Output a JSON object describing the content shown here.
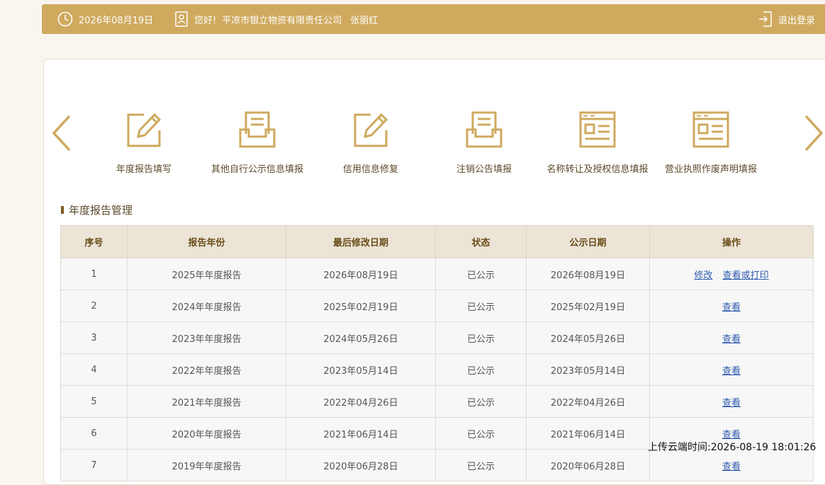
{
  "topbar": {
    "date": "2026年08月19日",
    "greeting": "您好!",
    "company": "平凉市银立物资有限责任公司",
    "user": "张丽红",
    "logout": "退出登录"
  },
  "nav": [
    {
      "label": "年度报告填写",
      "icon": "pencil-form-icon"
    },
    {
      "label": "其他自行公示信息填报",
      "icon": "document-tray-icon"
    },
    {
      "label": "信用信息修复",
      "icon": "pencil-form-icon"
    },
    {
      "label": "注销公告填报",
      "icon": "document-tray-icon"
    },
    {
      "label": "名称转让及授权信息填报",
      "icon": "browser-window-icon"
    },
    {
      "label": "营业执照作废声明填报",
      "icon": "browser-window-icon"
    }
  ],
  "section": {
    "title": "年度报告管理"
  },
  "table": {
    "headers": [
      "序号",
      "报告年份",
      "最后修改日期",
      "状态",
      "公示日期",
      "操作"
    ],
    "rows": [
      {
        "no": "1",
        "year": "2025年年度报告",
        "modified": "2026年08月19日",
        "status": "已公示",
        "published": "2026年08月19日",
        "actions": [
          "修改",
          "查看或打印"
        ]
      },
      {
        "no": "2",
        "year": "2024年年度报告",
        "modified": "2025年02月19日",
        "status": "已公示",
        "published": "2025年02月19日",
        "actions": [
          "查看"
        ]
      },
      {
        "no": "3",
        "year": "2023年年度报告",
        "modified": "2024年05月26日",
        "status": "已公示",
        "published": "2024年05月26日",
        "actions": [
          "查看"
        ]
      },
      {
        "no": "4",
        "year": "2022年年度报告",
        "modified": "2023年05月14日",
        "status": "已公示",
        "published": "2023年05月14日",
        "actions": [
          "查看"
        ]
      },
      {
        "no": "5",
        "year": "2021年年度报告",
        "modified": "2022年04月26日",
        "status": "已公示",
        "published": "2022年04月26日",
        "actions": [
          "查看"
        ]
      },
      {
        "no": "6",
        "year": "2020年年度报告",
        "modified": "2021年06月14日",
        "status": "已公示",
        "published": "2021年06月14日",
        "actions": [
          "查看"
        ]
      },
      {
        "no": "7",
        "year": "2019年年度报告",
        "modified": "2020年06月28日",
        "status": "已公示",
        "published": "2020年06月28日",
        "actions": [
          "查看"
        ]
      }
    ]
  },
  "footer": {
    "upload_time": "上传云端时间:2026-08-19 18:01:26"
  },
  "colors": {
    "accent": "#cfa95e",
    "header_bg": "#ebe4d7",
    "link": "#2f5bb0"
  }
}
